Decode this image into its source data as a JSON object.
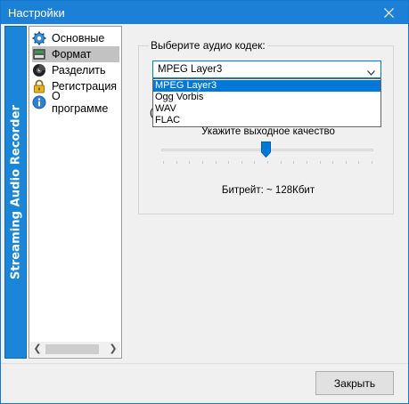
{
  "window": {
    "title": "Настройки"
  },
  "brand": {
    "text": "Streaming Audio Recorder"
  },
  "sidebar": {
    "items": [
      {
        "label": "Основные",
        "icon": "gear-icon",
        "selected": false
      },
      {
        "label": "Формат",
        "icon": "format-icon",
        "selected": true
      },
      {
        "label": "Разделить",
        "icon": "split-icon",
        "selected": false
      },
      {
        "label": "Регистрация",
        "icon": "lock-icon",
        "selected": false
      },
      {
        "label": "О программе",
        "icon": "info-icon",
        "selected": false
      }
    ]
  },
  "format": {
    "codec_label": "Выберите аудио кодек:",
    "codec_value": "MPEG Layer3",
    "codec_options": [
      "MPEG Layer3",
      "Ogg Vorbis",
      "WAV",
      "FLAC"
    ],
    "group_label_partial": "(",
    "quality_label": "Укажите выходное качество",
    "slider_level": 0.5,
    "bitrate_label": "Битрейт: ~ 128Кбит"
  },
  "footer": {
    "close_label": "Закрыть"
  },
  "colors": {
    "titlebar": "#1d80d8",
    "brand_strip": "#1b86d8",
    "selection": "#0078d7"
  }
}
